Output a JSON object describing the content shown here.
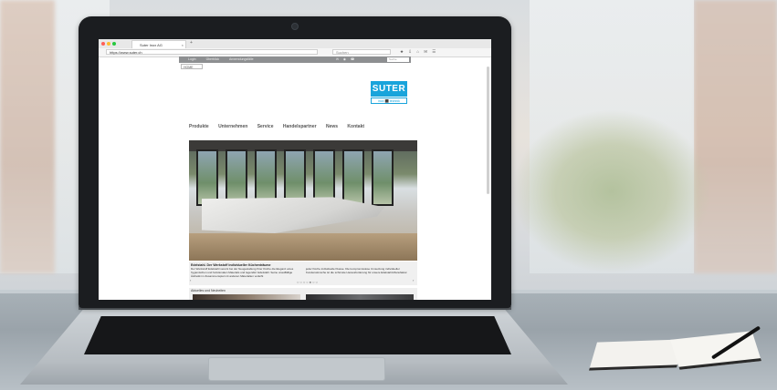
{
  "browser": {
    "tab_title": "Suter Inox AG",
    "tab_close": "×",
    "new_tab": "+",
    "url": "https://www.suter.ch",
    "search_placeholder": "Suchen",
    "toolbar_icons": "★ ⇩ ⌂ ✉ ☰"
  },
  "site": {
    "util_links": [
      "Login",
      "Überblick",
      "Anwendungsfälle"
    ],
    "util_icons": "✉ ◉ ☎",
    "search_placeholder": "Suche",
    "breadcrumb": "HOME",
    "logo": {
      "top": "SUTER",
      "bottom": "inox ⬛ technik",
      "color": "#19a4db"
    },
    "nav": [
      "Produkte",
      "Unternehmen",
      "Service",
      "Handelspartner",
      "News",
      "Kontakt"
    ],
    "hero": {
      "caption_title": "Edelstahl. Der Werkstoff individueller Küchenträume",
      "caption_left": "Der Werkstoff Edelstahl vereint bei der Neugestaltung Ihrer Küche die Eleganz eines hygienischen und funktionalen Materials und legendär: Edelstahl. Seine unauffällige Ästhetik im Zusammenspiel mit anderen Materialien verleiht",
      "caption_right": "jeder Küche individuelle Klasse. Die kompromisslose Umsetzung individueller Kundenwünsche ist die schönste Herausforderung für unsere Edelstahl-Manufaktur.",
      "pager": "○○○○●○○",
      "prev": "‹",
      "next": "›"
    },
    "news_title": "Aktuelles und Neuheiten"
  }
}
